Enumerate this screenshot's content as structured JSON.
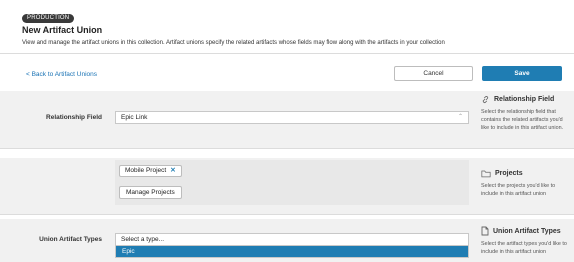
{
  "header": {
    "env_badge": "PRODUCTION",
    "title": "New Artifact Union",
    "description": "View and manage the artifact unions in this collection. Artifact unions specify the related artifacts whose fields may flow along with the artifacts in your collection"
  },
  "toolbar": {
    "back_label": "< Back to Artifact Unions",
    "cancel_label": "Cancel",
    "save_label": "Save"
  },
  "colors": {
    "accent": "#1f7db3",
    "band": "#f1f1f1"
  },
  "relationship": {
    "label": "Relationship Field",
    "value": "Epic Link",
    "help_title": "Relationship Field",
    "help_text": "Select the relationship field that contains the related artifacts you'd like to include in this artifact union.",
    "icon": "link-icon"
  },
  "projects": {
    "chips": [
      "Mobile Project"
    ],
    "manage_label": "Manage Projects",
    "help_title": "Projects",
    "help_text": "Select the projects you'd like to include in this artifact union",
    "icon": "folder-icon"
  },
  "types": {
    "label": "Union Artifact Types",
    "placeholder": "Select a type...",
    "options": [
      "Epic"
    ],
    "highlighted_option": "Epic",
    "help_title": "Union Artifact Types",
    "help_text": "Select the artifact types you'd like to include in this artifact union",
    "icon": "document-icon"
  }
}
